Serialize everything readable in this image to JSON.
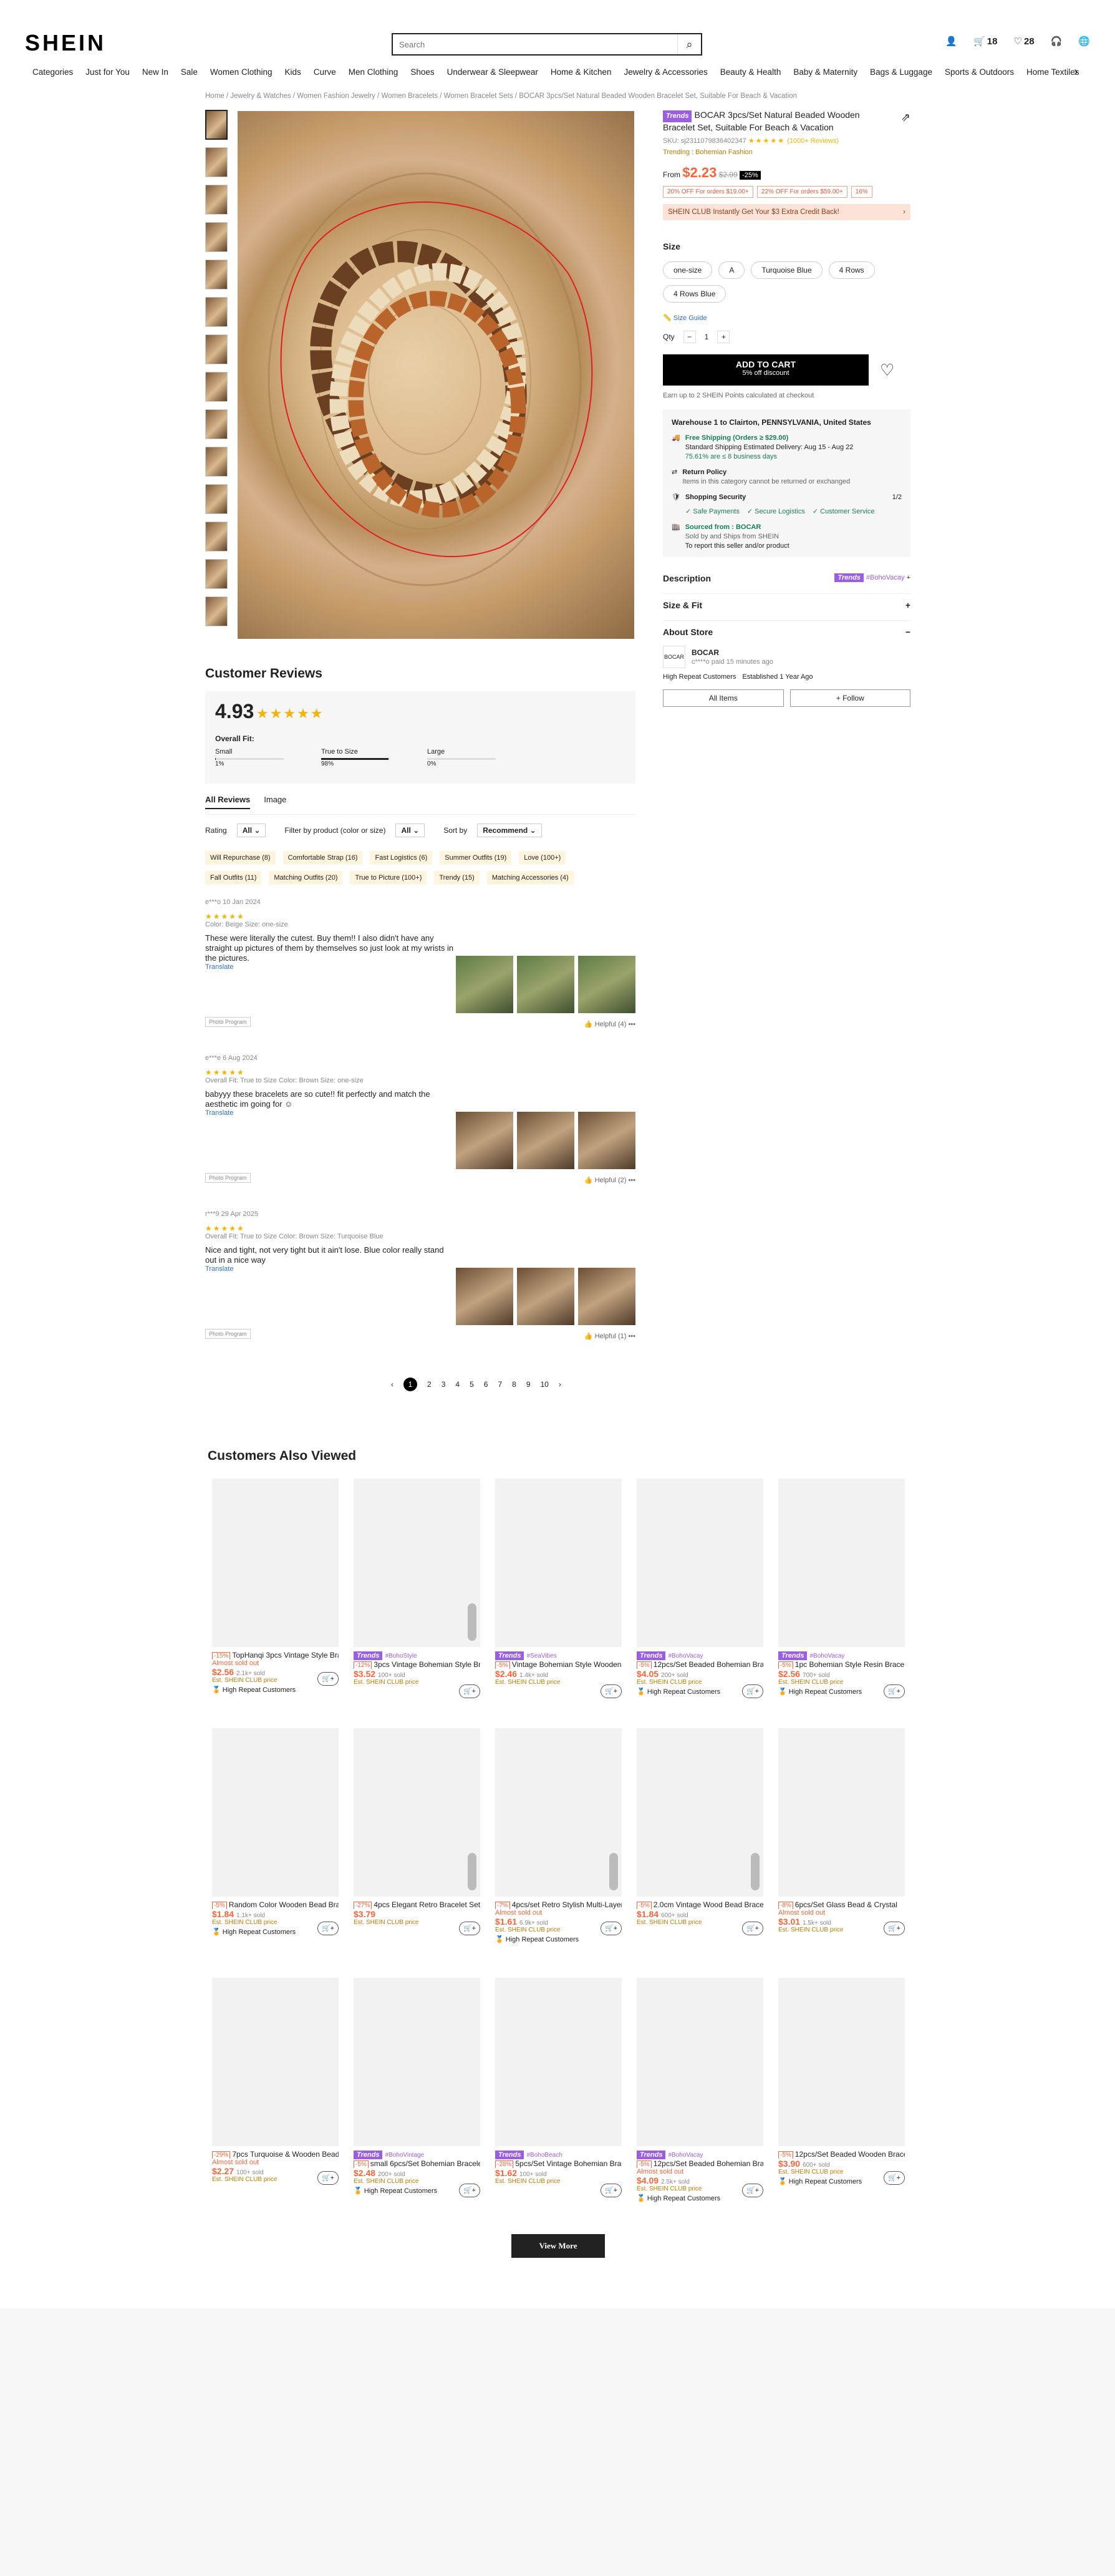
{
  "header": {
    "logo": "SHEIN",
    "search_placeholder": "Search",
    "cart_count": "18",
    "wish_count": "28"
  },
  "nav": [
    "Categories",
    "Just for You",
    "New In",
    "Sale",
    "Women Clothing",
    "Kids",
    "Curve",
    "Men Clothing",
    "Shoes",
    "Underwear & Sleepwear",
    "Home & Kitchen",
    "Jewelry & Accessories",
    "Beauty & Health",
    "Baby & Maternity",
    "Bags & Luggage",
    "Sports & Outdoors",
    "Home Textiles",
    "Electro"
  ],
  "breadcrumb": "Home / Jewelry & Watches / Women Fashion Jewelry / Women Bracelets / Women Bracelet Sets / BOCAR 3pcs/Set Natural Beaded Wooden Bracelet Set, Suitable For Beach & Vacation",
  "product": {
    "trends_tag": "Trends",
    "title": "BOCAR 3pcs/Set Natural Beaded Wooden Bracelet Set, Suitable For Beach & Vacation",
    "sku": "SKU: sj2311079836402347",
    "rating_count": "(1000+ Reviews)",
    "trending": "Trending : Bohemian Fashion",
    "price_from": "From",
    "price": "$2.23",
    "orig_price": "$2.99",
    "discount": "-25%",
    "coupons": [
      "20% OFF For orders $19.00+",
      "22% OFF For orders $59.00+",
      "16%"
    ],
    "club_text": "SHEIN CLUB  Instantly Get Your $3 Extra Credit Back!",
    "size_label": "Size",
    "sizes": [
      "one-size",
      "A",
      "Turquoise Blue",
      "4 Rows",
      "4 Rows Blue"
    ],
    "size_guide": "Size Guide",
    "qty_label": "Qty",
    "qty": "1",
    "add_to_cart": "ADD TO CART",
    "add_to_cart_sub": "5% off discount",
    "earn": "Earn up to 2 SHEIN Points calculated at checkout",
    "warehouse": "Warehouse 1 to  Clairton, PENNSYLVANIA, United States",
    "free_ship": "Free Shipping (Orders ≥ $29.00)",
    "ship_est": "Standard Shipping Estimated Delivery: Aug 15 - Aug 22",
    "ship_pct": "75.61% are ≤ 8 business days",
    "return_title": "Return Policy",
    "return_text": "Items in this category cannot be returned or exchanged",
    "security_title": "Shopping Security",
    "security_page": "1/2",
    "security_items": [
      "Safe Payments",
      "Secure Logistics",
      "Customer Service"
    ],
    "sourced": "Sourced from : BOCAR",
    "sold_by": "Sold by and Ships from SHEIN",
    "report": "To report this seller and/or product",
    "description": "Description",
    "desc_tag_trends": "Trends",
    "desc_tag": "#BohoVacay",
    "size_fit": "Size & Fit",
    "about_store": "About Store",
    "store_name": "BOCAR",
    "store_sub": "c****o paid 15 minutes ago",
    "store_badges": [
      "High Repeat Customers",
      "Established 1 Year Ago"
    ],
    "all_items": "All Items",
    "follow": "+ Follow"
  },
  "reviews": {
    "heading": "Customer Reviews",
    "score": "4.93",
    "overall_fit": "Overall Fit:",
    "fit": [
      {
        "label": "Small",
        "pct": "1%",
        "val": 1
      },
      {
        "label": "True to Size",
        "pct": "98%",
        "val": 98
      },
      {
        "label": "Large",
        "pct": "0%",
        "val": 0
      }
    ],
    "tabs": [
      "All Reviews",
      "Image"
    ],
    "rating_label": "Rating",
    "rating_val": "All",
    "filter_label": "Filter by product  (color or size)",
    "filter_val": "All",
    "sort_label": "Sort by",
    "sort_val": "Recommend",
    "tags": [
      "Will Repurchase (8)",
      "Comfortable Strap (16)",
      "Fast Logistics (6)",
      "Summer Outfits (19)",
      "Love (100+)",
      "Fall Outfits (11)",
      "Matching Outfits (20)",
      "True to Picture (100+)",
      "Trendy (15)",
      "Matching Accessories (4)"
    ],
    "items": [
      {
        "user": "e***o 10 Jan 2024",
        "meta": "Color: Beige    Size: one-size",
        "text": "These were literally the cutest. Buy them!! I also didn't have any straight up pictures of them by themselves so just look at my wrists in the pictures.",
        "helpful": "Helpful (4)"
      },
      {
        "user": "e***e 6 Aug 2024",
        "meta": "Overall Fit: True to Size    Color: Brown    Size: one-size",
        "text": "babyyy these bracelets are so cute!! fit perfectly and match the aesthetic im going for ☺",
        "helpful": "Helpful (2)"
      },
      {
        "user": "r***9 29 Apr 2025",
        "meta": "Overall Fit: True to Size    Color: Brown    Size: Turquoise Blue",
        "text": "Nice and tight, not very tight but it ain't lose. Blue color really stand out in a nice way",
        "helpful": "Helpful (1)"
      }
    ],
    "translate": "Translate",
    "photo_program": "Photo Program",
    "pages": [
      "1",
      "2",
      "3",
      "4",
      "5",
      "6",
      "7",
      "8",
      "9",
      "10"
    ]
  },
  "also_viewed": {
    "heading": "Customers Also Viewed",
    "view_more": "View More",
    "cards": [
      {
        "tag": "",
        "pct": "-15%",
        "title": "TopHanqi 3pcs Vintage Style Bracelet",
        "price": "$2.56",
        "sold": "2.1k+ sold",
        "almost": "Almost sold out",
        "est": "Est. SHEIN CLUB price",
        "hrc": "High Repeat Customers"
      },
      {
        "tag": "#BohoStyle",
        "pct": "-12%",
        "title": "3pcs Vintage Bohemian Style Bracelets",
        "price": "$3.52",
        "sold": "100+ sold",
        "almost": "",
        "est": "Est. SHEIN CLUB price",
        "hrc": ""
      },
      {
        "tag": "#SeaVibes",
        "pct": "-5%",
        "title": "Vintage Bohemian Style Wooden Bead",
        "price": "$2.46",
        "sold": "1.4k+ sold",
        "almost": "",
        "est": "Est. SHEIN CLUB price",
        "hrc": ""
      },
      {
        "tag": "#BohoVacay",
        "pct": "-5%",
        "title": "12pcs/Set Beaded Bohemian Bracelet",
        "price": "$4.05",
        "sold": "200+ sold",
        "almost": "",
        "est": "Est. SHEIN CLUB price",
        "hrc": "High Repeat Customers"
      },
      {
        "tag": "#BohoVacay",
        "pct": "-5%",
        "title": "1pc Bohemian Style Resin Bracelet",
        "price": "$2.56",
        "sold": "700+ sold",
        "almost": "",
        "est": "Est. SHEIN CLUB price",
        "hrc": "High Repeat Customers"
      },
      {
        "tag": "",
        "pct": "-5%",
        "title": "Random Color Wooden Bead Bracelet",
        "price": "$1.84",
        "sold": "1.1k+ sold",
        "almost": "",
        "est": "Est. SHEIN CLUB price",
        "hrc": "High Repeat Customers"
      },
      {
        "tag": "",
        "pct": "-27%",
        "title": "4pcs Elegant Retro Bracelet Set",
        "price": "$3.79",
        "sold": "",
        "almost": "",
        "est": "Est. SHEIN CLUB price",
        "hrc": ""
      },
      {
        "tag": "",
        "pct": "-7%",
        "title": "4pcs/set Retro Stylish Multi-Layer",
        "price": "$1.61",
        "sold": "6.9k+ sold",
        "almost": "Almost sold out",
        "est": "Est. SHEIN CLUB price",
        "hrc": "High Repeat Customers"
      },
      {
        "tag": "",
        "pct": "-5%",
        "title": "2.0cm Vintage Wood Bead Bracelet",
        "price": "$1.84",
        "sold": "600+ sold",
        "almost": "",
        "est": "Est. SHEIN CLUB price",
        "hrc": ""
      },
      {
        "tag": "",
        "pct": "-8%",
        "title": "6pcs/Set Glass Bead & Crystal",
        "price": "$3.01",
        "sold": "1.5k+ sold",
        "almost": "Almost sold out",
        "est": "Est. SHEIN CLUB price",
        "hrc": ""
      },
      {
        "tag": "",
        "pct": "-29%",
        "title": "7pcs Turquoise & Wooden Bead",
        "price": "$2.27",
        "sold": "100+ sold",
        "almost": "Almost sold out",
        "est": "Est. SHEIN CLUB price",
        "hrc": ""
      },
      {
        "tag": "#BohoVintage",
        "pct": "-5%",
        "title": "small 6pcs/Set Bohemian Bracelet",
        "price": "$2.48",
        "sold": "200+ sold",
        "almost": "",
        "est": "Est. SHEIN CLUB price",
        "hrc": "High Repeat Customers"
      },
      {
        "tag": "#BohoBeach",
        "pct": "-28%",
        "title": "5pcs/Set Vintage Bohemian Bracelet",
        "price": "$1.62",
        "sold": "100+ sold",
        "almost": "",
        "est": "Est. SHEIN CLUB price",
        "hrc": ""
      },
      {
        "tag": "#BohoVacay",
        "pct": "-5%",
        "title": "12pcs/Set Beaded Bohemian Bracelet",
        "price": "$4.09",
        "sold": "2.5k+ sold",
        "almost": "Almost sold out",
        "est": "Est. SHEIN CLUB price",
        "hrc": "High Repeat Customers"
      },
      {
        "tag": "",
        "pct": "-5%",
        "title": "12pcs/Set Beaded Wooden Bracelet",
        "price": "$3.90",
        "sold": "600+ sold",
        "almost": "",
        "est": "Est. SHEIN CLUB price",
        "hrc": "High Repeat Customers"
      }
    ]
  }
}
